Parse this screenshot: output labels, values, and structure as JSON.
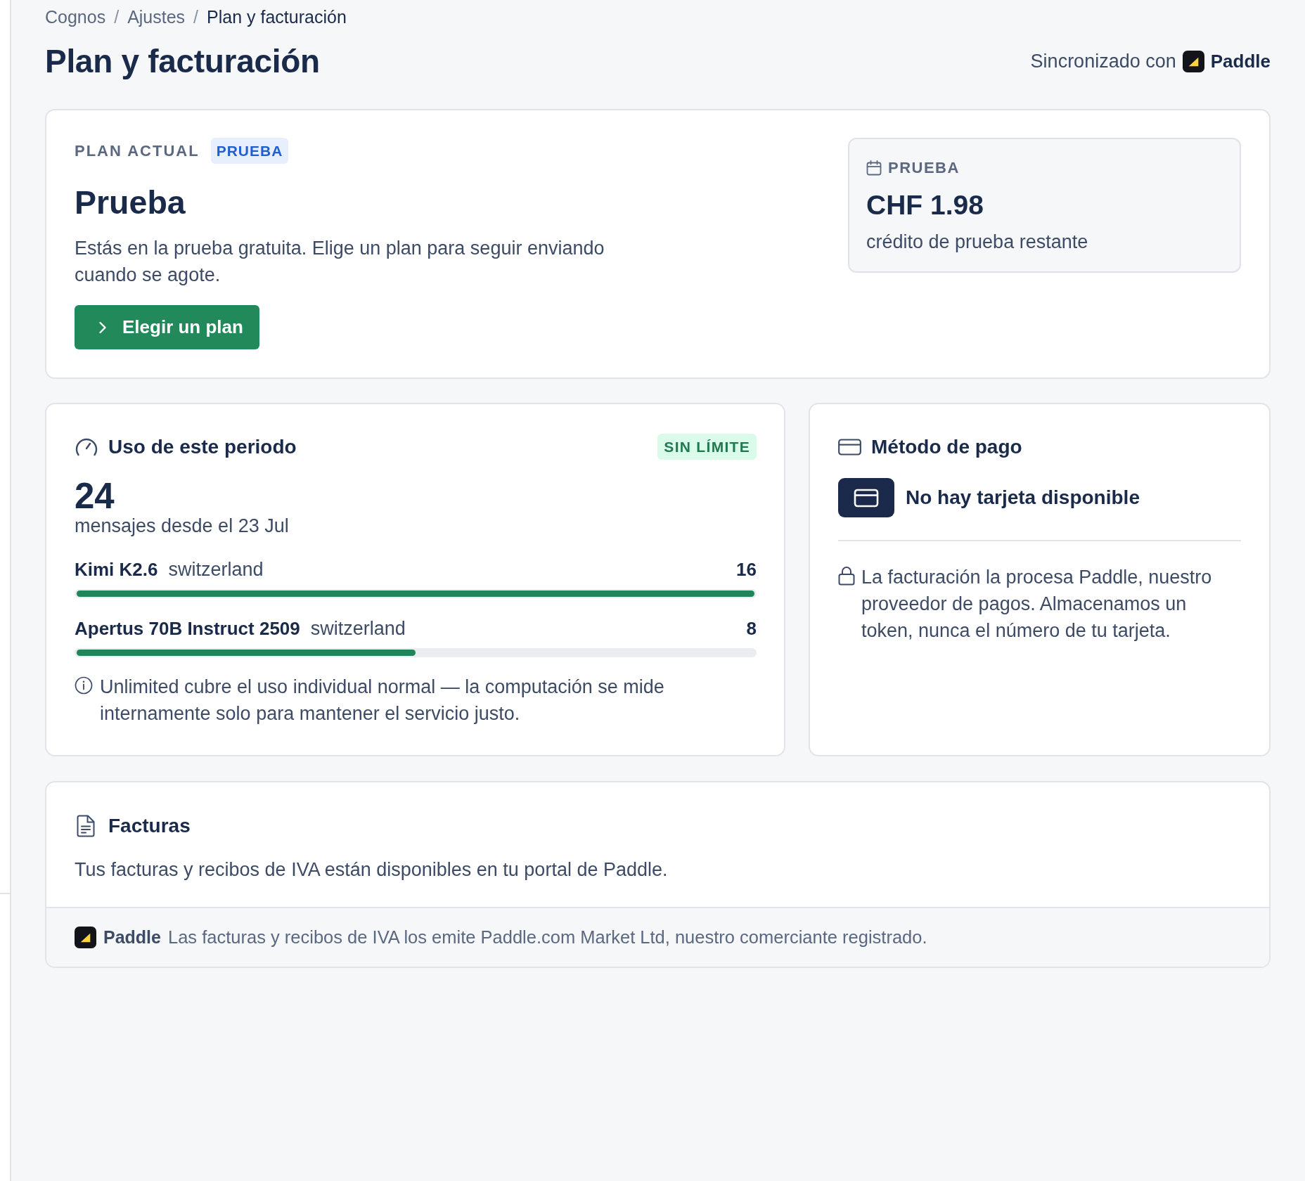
{
  "breadcrumb": {
    "separator": "/",
    "items": [
      {
        "label": "Cognos",
        "current": false
      },
      {
        "label": "Ajustes",
        "current": false
      },
      {
        "label": "Plan y facturación",
        "current": true
      }
    ]
  },
  "header": {
    "title": "Plan y facturación",
    "sync_label": "Sincronizado con",
    "provider": "Paddle"
  },
  "plan_card": {
    "label": "PLAN ACTUAL",
    "badge": "PRUEBA",
    "name": "Prueba",
    "description": "Estás en la prueba gratuita. Elige un plan para seguir enviando cuando se agote.",
    "button": "Elegir un plan",
    "trial": {
      "label": "PRUEBA",
      "amount": "CHF 1.98",
      "caption": "crédito de prueba restante"
    }
  },
  "usage_card": {
    "title": "Uso de este periodo",
    "badge": "SIN LÍMITE",
    "count": "24",
    "caption": "mensajes desde el 23 Jul",
    "models": [
      {
        "name": "Kimi K2.6",
        "region": "switzerland",
        "count": "16",
        "level": 1
      },
      {
        "name": "Apertus 70B Instruct 2509",
        "region": "switzerland",
        "count": "8",
        "level": 0.5
      }
    ],
    "note": "Unlimited cubre el uso individual normal — la computación se mide internamente solo para mantener el servicio justo."
  },
  "payment_card": {
    "title": "Método de pago",
    "card_status": "No hay tarjeta disponible",
    "note": "La facturación la procesa Paddle, nuestro proveedor de pagos. Almacenamos un token, nunca el número de tu tarjeta."
  },
  "invoices_card": {
    "title": "Facturas",
    "description": "Tus facturas y recibos de IVA están disponibles en tu portal de Paddle.",
    "footer": {
      "provider": "Paddle",
      "text": "Las facturas y recibos de IVA los emite Paddle.com Market Ltd, nuestro comerciante registrado."
    }
  }
}
